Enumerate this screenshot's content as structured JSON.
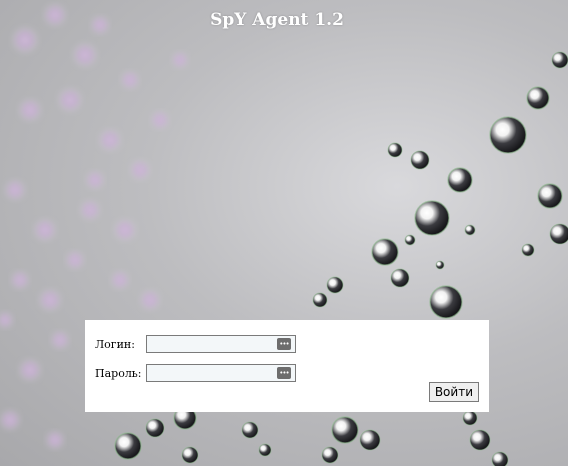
{
  "title": "SpY Agent 1.2",
  "form": {
    "login_label": "Логин:",
    "login_value": "",
    "password_label": "Пароль:",
    "password_value": "",
    "submit_label": "Войти",
    "key_icon": "password-manager-icon"
  },
  "colors": {
    "background": "#b9b9bc",
    "panel": "#ffffff",
    "field_bg": "#f3f7f9",
    "title": "#ffffff",
    "droplet_dark": "#2a2a2e",
    "droplet_tint": "#c7a6d6",
    "droplet_green": "#9ac49a"
  }
}
